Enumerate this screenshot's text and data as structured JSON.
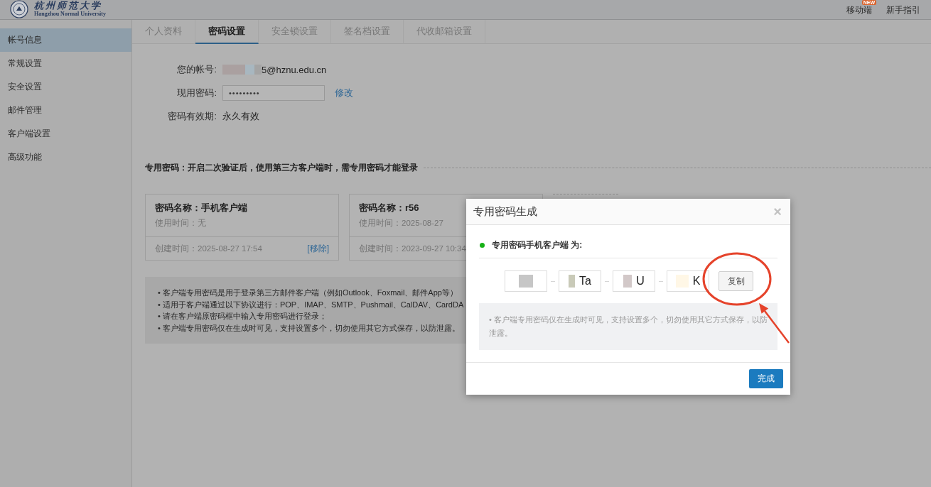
{
  "header": {
    "logo": {
      "title": "杭州师范大学",
      "subtitle": "Hangzhou Normal University"
    },
    "links": [
      {
        "label": "移动端",
        "badge": "NEW"
      },
      {
        "label": "新手指引"
      }
    ]
  },
  "sidebar": {
    "items": [
      {
        "label": "帐号信息",
        "selected": true
      },
      {
        "label": "常规设置",
        "selected": false
      },
      {
        "label": "安全设置",
        "selected": false
      },
      {
        "label": "邮件管理",
        "selected": false
      },
      {
        "label": "客户端设置",
        "selected": false
      },
      {
        "label": "高级功能",
        "selected": false
      }
    ]
  },
  "tabs": [
    {
      "label": "个人资料",
      "selected": false
    },
    {
      "label": "密码设置",
      "selected": true
    },
    {
      "label": "安全锁设置",
      "selected": false
    },
    {
      "label": "签名档设置",
      "selected": false
    },
    {
      "label": "代收邮箱设置",
      "selected": false
    }
  ],
  "account_form": {
    "fields": [
      {
        "kind": "text",
        "label": "您的帐号:",
        "value": "5@hznu.edu.cn",
        "redacted": true
      },
      {
        "kind": "password",
        "label": "现用密码:",
        "value": "•••••••••",
        "action": "修改"
      },
      {
        "kind": "text",
        "label": "密码有效期:",
        "value": "永久有效"
      }
    ]
  },
  "app_passwords": {
    "title": "专用密码：开启二次验证后，使用第三方客户端时，需专用密码才能登录",
    "cards": [
      {
        "name": "密码名称：手机客户端",
        "used": "使用时间：无",
        "created": "创建时间：2025-08-27 17:54",
        "action": "[移除]"
      },
      {
        "name": "密码名称：r56",
        "used": "使用时间：2025-08-27",
        "created": "创建时间：2023-09-27 10:34"
      }
    ],
    "notes": [
      "• 客户端专用密码是用于登录第三方邮件客户端（例如Outlook、Foxmail、邮件App等）",
      "• 适用于客户端通过以下协议进行：POP、IMAP、SMTP、Pushmail、CalDAV、CardDA",
      "• 请在客户端原密码框中输入专用密码进行登录；",
      "• 客户端专用密码仅在生成时可见，支持设置多个，切勿使用其它方式保存，以防泄露。"
    ]
  },
  "dialog": {
    "title": "专用密码生成",
    "close": "×",
    "message": "专用密码手机客户端 为:",
    "segments": [
      {
        "redacted": true
      },
      {
        "value": "Ta",
        "redacted": true
      },
      {
        "value": "U",
        "redacted": true
      },
      {
        "value": "K",
        "redacted": true
      }
    ],
    "copy_button": "复制",
    "notice": "• 客户端专用密码仅在生成时可见，支持设置多个，切勿使用其它方式保存，以防泄露。",
    "done_button": "完成"
  }
}
